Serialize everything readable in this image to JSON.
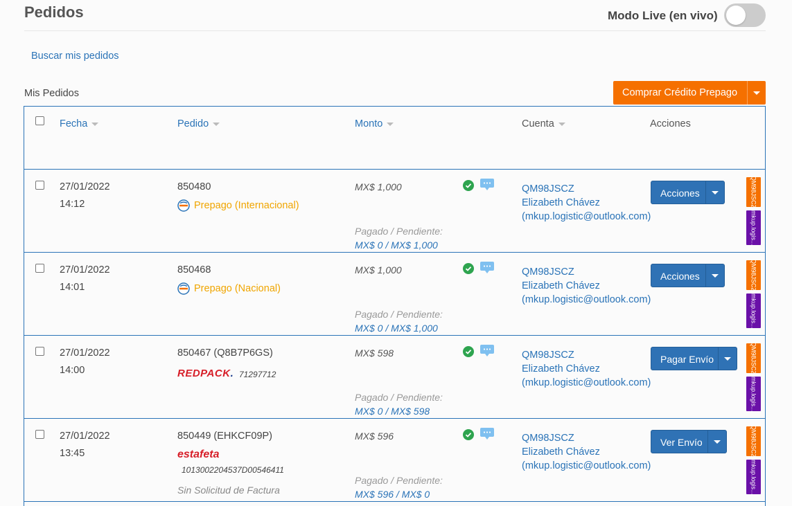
{
  "header": {
    "title": "Pedidos",
    "live_label": "Modo Live (en vivo)",
    "live_enabled": false
  },
  "search_link": "Buscar mis pedidos",
  "section_label": "Mis Pedidos",
  "buy_button": {
    "label": "Comprar Crédito Prepago",
    "color": "#f57000"
  },
  "table": {
    "columns": {
      "date": "Fecha",
      "order": "Pedido",
      "amount": "Monto",
      "account": "Cuenta",
      "actions": "Acciones"
    },
    "paid_label": "Pagado / Pendiente:",
    "rows": [
      {
        "date": "27/01/2022",
        "time": "14:12",
        "order_id": "850480",
        "prepago": "Prepago (Internacional)",
        "amount": "MX$ 1,000",
        "paid": "MX$ 0 / MX$ 1,000",
        "account_id": "QM98JSCZ",
        "account_name": "Elizabeth Chávez",
        "account_email": "(mkup.logistic@outlook.com)",
        "action": "Acciones",
        "tag_id": "QM98JSCZ",
        "tag_user": "mkup.logis..."
      },
      {
        "date": "27/01/2022",
        "time": "14:01",
        "order_id": "850468",
        "prepago": "Prepago (Nacional)",
        "amount": "MX$ 1,000",
        "paid": "MX$ 0 / MX$ 1,000",
        "account_id": "QM98JSCZ",
        "account_name": "Elizabeth Chávez",
        "account_email": "(mkup.logistic@outlook.com)",
        "action": "Acciones",
        "tag_id": "QM98JSCZ",
        "tag_user": "mkup.logis..."
      },
      {
        "date": "27/01/2022",
        "time": "14:00",
        "order_id": "850467 (Q8B7P6GS)",
        "carrier": "REDPACK",
        "tracking": "71297712",
        "amount": "MX$ 598",
        "paid": "MX$ 0 / MX$ 598",
        "account_id": "QM98JSCZ",
        "account_name": "Elizabeth Chávez",
        "account_email": "(mkup.logistic@outlook.com)",
        "action": "Pagar Envío",
        "tag_id": "QM98JSCZ",
        "tag_user": "mkup.logis..."
      },
      {
        "date": "27/01/2022",
        "time": "13:45",
        "order_id": "850449 (EHKCF09P)",
        "carrier": "estafeta",
        "tracking": "1013002204537D00546411",
        "invoice": "Sin Solicitud de Factura",
        "amount": "MX$ 596",
        "paid": "MX$ 596 / MX$ 0",
        "account_id": "QM98JSCZ",
        "account_name": "Elizabeth Chávez",
        "account_email": "(mkup.logistic@outlook.com)",
        "action": "Ver Envío",
        "tag_id": "QM98JSCZ",
        "tag_user": "mkup.logis..."
      }
    ]
  },
  "icons": [
    "checkbox",
    "sort-caret-icon",
    "check-circle-icon",
    "chat-bubble-icon",
    "prepago-logo-icon",
    "caret-down-icon"
  ],
  "colors": {
    "link": "#2a73b7",
    "orange": "#f57000",
    "purple": "#6a10a8",
    "green": "#2ea44f",
    "prepago": "#f0a500"
  }
}
